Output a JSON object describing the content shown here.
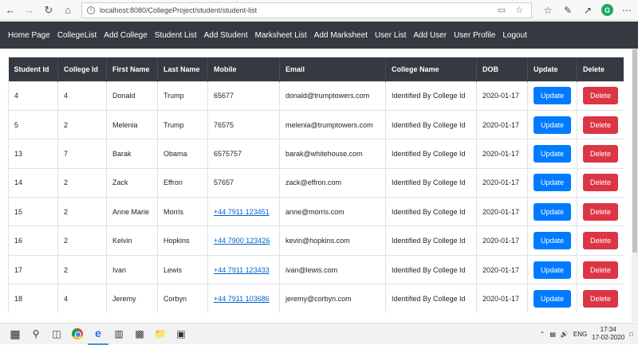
{
  "browser": {
    "url": "localhost:8080/CollegeProject/student/student-list"
  },
  "nav": {
    "items": [
      "Home Page",
      "CollegeList",
      "Add College",
      "Student List",
      "Add Student",
      "Marksheet List",
      "Add Marksheet",
      "User List",
      "Add User",
      "User Profile",
      "Logout"
    ]
  },
  "table": {
    "columns": [
      "Student Id",
      "College Id",
      "First Name",
      "Last Name",
      "Mobile",
      "Email",
      "College Name",
      "DOB",
      "Update",
      "Delete"
    ],
    "update_label": "Update",
    "delete_label": "Delete",
    "rows": [
      {
        "student_id": "4",
        "college_id": "4",
        "first_name": "Donald",
        "last_name": "Trump",
        "mobile": "65677",
        "mobile_link": false,
        "email": "donald@trumptowers.com",
        "college_name": "Identified By College Id",
        "dob": "2020-01-17"
      },
      {
        "student_id": "5",
        "college_id": "2",
        "first_name": "Melenia",
        "last_name": "Trump",
        "mobile": "76575",
        "mobile_link": false,
        "email": "melenia@trumptowers.com",
        "college_name": "Identified By College Id",
        "dob": "2020-01-17"
      },
      {
        "student_id": "13",
        "college_id": "7",
        "first_name": "Barak",
        "last_name": "Obama",
        "mobile": "6575757",
        "mobile_link": false,
        "email": "barak@whitehouse.com",
        "college_name": "Identified By College Id",
        "dob": "2020-01-17"
      },
      {
        "student_id": "14",
        "college_id": "2",
        "first_name": "Zack",
        "last_name": "Effron",
        "mobile": "57657",
        "mobile_link": false,
        "email": "zack@effron.com",
        "college_name": "Identified By College Id",
        "dob": "2020-01-17"
      },
      {
        "student_id": "15",
        "college_id": "2",
        "first_name": "Anne Marie",
        "last_name": "Morris",
        "mobile": "+44 7911 123451",
        "mobile_link": true,
        "email": "anne@morris.com",
        "college_name": "Identified By College Id",
        "dob": "2020-01-17"
      },
      {
        "student_id": "16",
        "college_id": "2",
        "first_name": "Kelvin",
        "last_name": "Hopkins",
        "mobile": "+44 7900 123426",
        "mobile_link": true,
        "email": "kevin@hopkins.com",
        "college_name": "Identified By College Id",
        "dob": "2020-01-17"
      },
      {
        "student_id": "17",
        "college_id": "2",
        "first_name": "Ivan",
        "last_name": "Lewis",
        "mobile": "+44 7911 123433",
        "mobile_link": true,
        "email": "ivan@lewis.com",
        "college_name": "Identified By College Id",
        "dob": "2020-01-17"
      },
      {
        "student_id": "18",
        "college_id": "4",
        "first_name": "Jeremy",
        "last_name": "Corbyn",
        "mobile": "+44 7911 103686",
        "mobile_link": true,
        "email": "jeremy@corbyn.com",
        "college_name": "Identified By College Id",
        "dob": "2020-01-17"
      }
    ]
  },
  "taskbar": {
    "language": "ENG",
    "time": "17:34",
    "date": "17-02-2020"
  },
  "icons": {
    "back": "back-arrow-icon",
    "forward": "forward-arrow-icon",
    "refresh": "refresh-icon",
    "home": "home-icon"
  }
}
